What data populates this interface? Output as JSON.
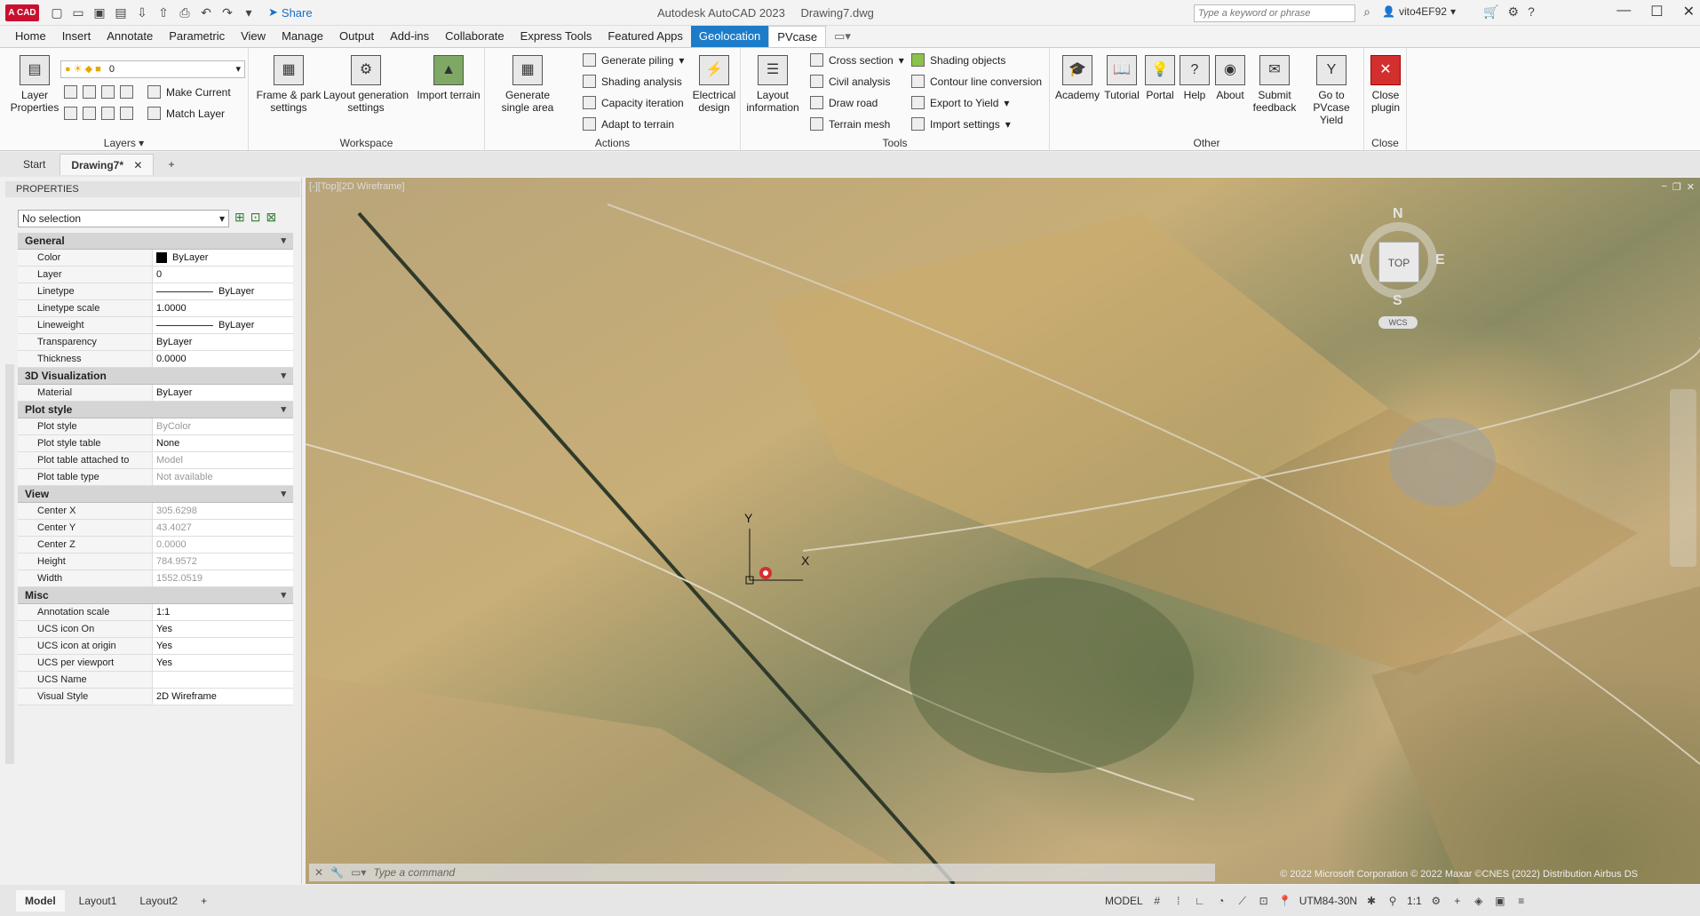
{
  "titlebar": {
    "logo": "A CAD",
    "share": "Share",
    "app_name": "Autodesk AutoCAD 2023",
    "doc_name": "Drawing7.dwg",
    "search_placeholder": "Type a keyword or phrase",
    "user": "vito4EF92"
  },
  "menu_tabs": [
    "Home",
    "Insert",
    "Annotate",
    "Parametric",
    "View",
    "Manage",
    "Output",
    "Add-ins",
    "Collaborate",
    "Express Tools",
    "Featured Apps",
    "Geolocation",
    "PVcase"
  ],
  "ribbon": {
    "layers": {
      "title": "Layers",
      "layer_properties": "Layer Properties",
      "layer_value": "0",
      "make_current": "Make Current",
      "match_layer": "Match Layer"
    },
    "workspace": {
      "title": "Workspace",
      "frame_park": "Frame & park settings",
      "layout_gen": "Layout generation settings",
      "import_terrain": "Import terrain"
    },
    "actions": {
      "title": "Actions",
      "generate_single": "Generate single area",
      "generate_piling": "Generate piling",
      "shading_analysis": "Shading analysis",
      "capacity_iteration": "Capacity iteration",
      "adapt_terrain": "Adapt to terrain",
      "electrical_design": "Electrical design"
    },
    "tools": {
      "title": "Tools",
      "layout_info": "Layout information",
      "cross_section": "Cross section",
      "civil_analysis": "Civil analysis",
      "draw_road": "Draw road",
      "terrain_mesh": "Terrain mesh",
      "shading_objects": "Shading objects",
      "contour_conversion": "Contour line conversion",
      "export_yield": "Export to Yield",
      "import_settings": "Import settings"
    },
    "other": {
      "title": "Other",
      "academy": "Academy",
      "tutorial": "Tutorial",
      "portal": "Portal",
      "help": "Help",
      "about": "About",
      "submit_feedback": "Submit feedback",
      "go_yield": "Go to PVcase Yield"
    },
    "close": {
      "title": "Close",
      "close_plugin": "Close plugin"
    }
  },
  "doc_tabs": [
    "Start",
    "Drawing7*"
  ],
  "properties": {
    "title": "PROPERTIES",
    "selection": "No selection",
    "general": {
      "label": "General",
      "rows": [
        {
          "k": "Color",
          "v": "ByLayer"
        },
        {
          "k": "Layer",
          "v": "0"
        },
        {
          "k": "Linetype",
          "v": "ByLayer"
        },
        {
          "k": "Linetype scale",
          "v": "1.0000"
        },
        {
          "k": "Lineweight",
          "v": "ByLayer"
        },
        {
          "k": "Transparency",
          "v": "ByLayer"
        },
        {
          "k": "Thickness",
          "v": "0.0000"
        }
      ]
    },
    "viz": {
      "label": "3D Visualization",
      "rows": [
        {
          "k": "Material",
          "v": "ByLayer"
        }
      ]
    },
    "plot": {
      "label": "Plot style",
      "rows": [
        {
          "k": "Plot style",
          "v": "ByColor"
        },
        {
          "k": "Plot style table",
          "v": "None"
        },
        {
          "k": "Plot table attached to",
          "v": "Model"
        },
        {
          "k": "Plot table type",
          "v": "Not available"
        }
      ]
    },
    "view": {
      "label": "View",
      "rows": [
        {
          "k": "Center X",
          "v": "305.6298"
        },
        {
          "k": "Center Y",
          "v": "43.4027"
        },
        {
          "k": "Center Z",
          "v": "0.0000"
        },
        {
          "k": "Height",
          "v": "784.9572"
        },
        {
          "k": "Width",
          "v": "1552.0519"
        }
      ]
    },
    "misc": {
      "label": "Misc",
      "rows": [
        {
          "k": "Annotation scale",
          "v": "1:1"
        },
        {
          "k": "UCS icon On",
          "v": "Yes"
        },
        {
          "k": "UCS icon at origin",
          "v": "Yes"
        },
        {
          "k": "UCS per viewport",
          "v": "Yes"
        },
        {
          "k": "UCS Name",
          "v": ""
        },
        {
          "k": "Visual Style",
          "v": "2D Wireframe"
        }
      ]
    }
  },
  "viewport": {
    "label": "[-][Top][2D Wireframe]",
    "compass": {
      "n": "N",
      "s": "S",
      "e": "E",
      "w": "W",
      "cube": "TOP",
      "wcs": "WCS"
    },
    "ucs_x": "X",
    "ucs_y": "Y",
    "command_placeholder": "Type a command",
    "copyright": "© 2022 Microsoft Corporation © 2022 Maxar ©CNES (2022) Distribution Airbus DS"
  },
  "layout_tabs": [
    "Model",
    "Layout1",
    "Layout2"
  ],
  "status": {
    "model": "MODEL",
    "coord_system": "UTM84-30N",
    "scale": "1:1"
  },
  "colors": {
    "accent": "#1c7cc9",
    "logo": "#c8102e",
    "close_plugin": "#d32f2f"
  }
}
